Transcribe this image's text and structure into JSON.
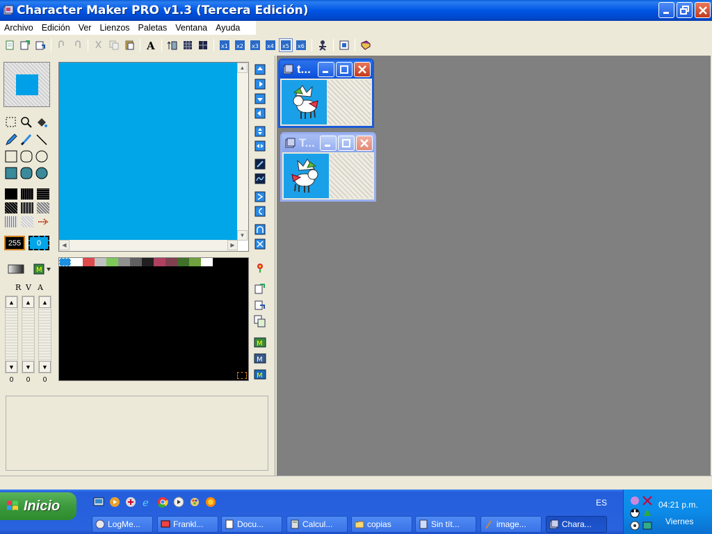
{
  "window": {
    "title": "Character Maker PRO v1.3 (Tercera Edición)"
  },
  "menu": [
    "Archivo",
    "Edición",
    "Ver",
    "Lienzos",
    "Paletas",
    "Ventana",
    "Ayuda"
  ],
  "left": {
    "num_box_1": "255",
    "num_box_2": "0",
    "rva_labels": [
      "R",
      "V",
      "A"
    ],
    "slider_values": [
      "0",
      "0",
      "0"
    ]
  },
  "palette_colors": [
    "#1e8fe0",
    "#ffffff",
    "#e04a4a",
    "#c0c0c0",
    "#7ec85a",
    "#909090",
    "#606060",
    "#202020",
    "#b04060",
    "#804050",
    "#40702a",
    "#70a040",
    "#ffffff"
  ],
  "children": [
    {
      "title": "t..."
    },
    {
      "title": "T..."
    }
  ],
  "taskbar": {
    "start_label": "Inicio",
    "language": "ES",
    "clock": "04:21 p.m.",
    "day": "Viernes",
    "tasks": [
      "LogMe...",
      "Frankl...",
      "Docu...",
      "Calcul...",
      "copias",
      "Sin tít...",
      "image...",
      "Chara..."
    ]
  },
  "colors": {
    "canvas": "#00a6e8",
    "mdi_bg": "#808080",
    "title_blue": "#0055e5"
  }
}
